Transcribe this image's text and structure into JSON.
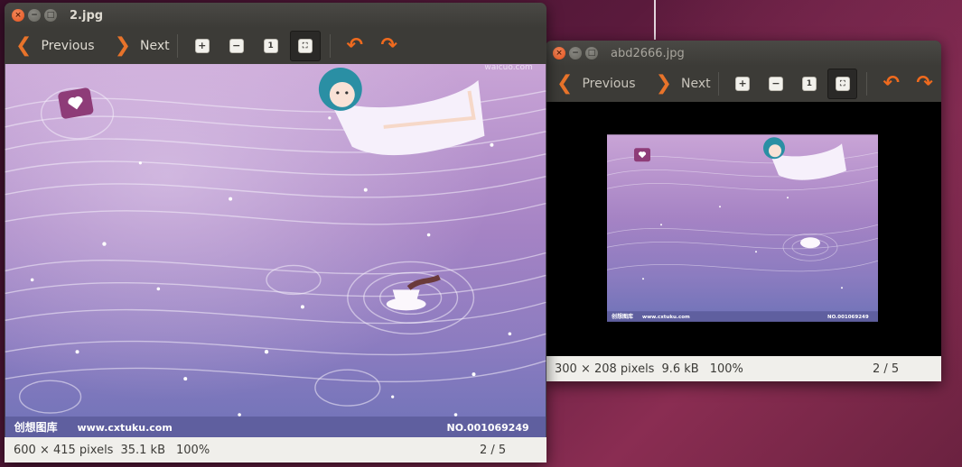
{
  "windows": [
    {
      "title": "2.jpg",
      "toolbar": {
        "previous_label": "Previous",
        "next_label": "Next"
      },
      "status": {
        "dimensions": "600 × 415 pixels",
        "size": "35.1 kB",
        "zoom": "100%",
        "page": "2 / 5"
      },
      "image": {
        "watermark_left": "创想图库",
        "watermark_url": "www.cxtuku.com",
        "watermark_no": "NO.001069249",
        "corner_text": "waicuo.com"
      }
    },
    {
      "title": "abd2666.jpg",
      "toolbar": {
        "previous_label": "Previous",
        "next_label": "Next"
      },
      "status": {
        "dimensions": "300 × 208 pixels",
        "size": "9.6 kB",
        "zoom": "100%",
        "page": "2 / 5"
      },
      "image": {
        "watermark_left": "创想图库",
        "watermark_url": "www.cxtuku.com",
        "watermark_no": "NO.001069249"
      }
    }
  ],
  "icons": {
    "previous": "chevron-left-icon",
    "next": "chevron-right-icon",
    "zoom_in": "zoom-in-icon",
    "zoom_out": "zoom-out-icon",
    "normal_size": "normal-size-icon",
    "best_fit": "best-fit-icon",
    "rotate_left": "rotate-left-icon",
    "rotate_right": "rotate-right-icon"
  },
  "colors": {
    "accent": "#e8732a",
    "titlebar": "#3c3b37",
    "statusbar": "#f0efeb",
    "close_button": "#e2501c"
  }
}
